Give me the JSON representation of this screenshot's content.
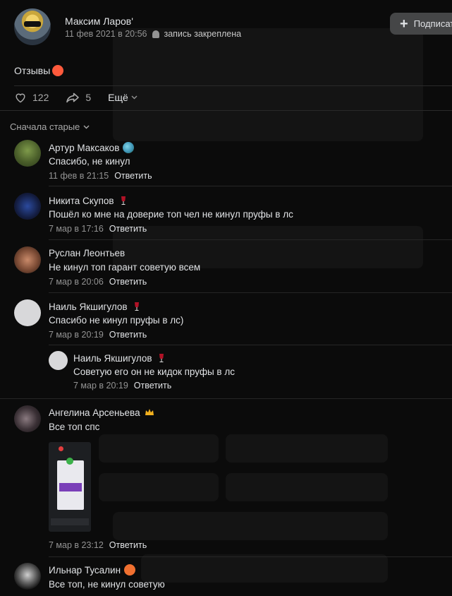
{
  "post": {
    "author": "Максим Ларов'",
    "date": "11 фев 2021 в 20:56",
    "pinned": "запись закреплена",
    "subscribe_label": "Подписаться",
    "text": "Отзывы",
    "likes": "122",
    "shares": "5",
    "more": "Ещё"
  },
  "sort": {
    "label": "Сначала старые"
  },
  "comments": [
    {
      "name": "Артур Максаков",
      "badge": "globe-icon",
      "text": "Спасибо, не кинул",
      "date": "11 фев в 21:15",
      "reply": "Ответить"
    },
    {
      "name": "Никита Скупов",
      "badge": "wine-icon",
      "text": "Пошёл ко мне на доверие топ чел не кинул пруфы в лс",
      "date": "7 мар в 17:16",
      "reply": "Ответить"
    },
    {
      "name": "Руслан Леонтьев",
      "badge": "",
      "text": "Не кинул топ гарант советую всем",
      "date": "7 мар в 20:06",
      "reply": "Ответить"
    },
    {
      "name": "Наиль Якшигулов",
      "badge": "wine-icon",
      "text": "Спасибо не кинул пруфы в лс)",
      "date": "7 мар в 20:19",
      "reply": "Ответить"
    },
    {
      "name": "Наиль Якшигулов",
      "badge": "wine-icon",
      "text": "Советую его он не кидок пруфы в лс",
      "date": "7 мар в 20:19",
      "reply": "Ответить"
    },
    {
      "name": "Ангелина Арсеньева",
      "badge": "crown-icon",
      "text": "Все топ спс",
      "date": "7 мар в 23:12",
      "reply": "Ответить"
    },
    {
      "name": "Ильнар Тусалин",
      "badge": "angry-face-icon",
      "text": "Все топ, не кинул советую",
      "date": "",
      "reply": ""
    }
  ],
  "colors": {
    "background": "#0b0b0b",
    "text": "#e1e3e6",
    "secondary": "#939393",
    "button": "#454647"
  }
}
